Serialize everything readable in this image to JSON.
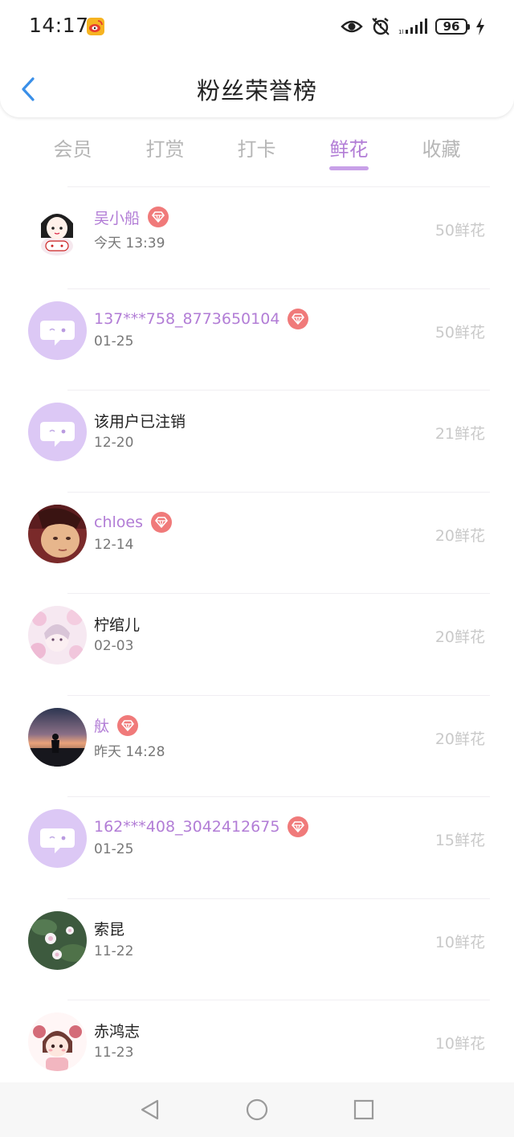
{
  "status_bar": {
    "time": "14:17",
    "battery": "96",
    "icons": [
      "weibo-icon",
      "eye-icon",
      "alarm-icon",
      "signal-icon",
      "battery-icon",
      "charging-icon"
    ]
  },
  "header": {
    "title": "粉丝荣誉榜",
    "back_icon": "chevron-left-icon"
  },
  "tabs": [
    {
      "label": "会员"
    },
    {
      "label": "打赏"
    },
    {
      "label": "打卡"
    },
    {
      "label": "鲜花",
      "active": true
    },
    {
      "label": "收藏"
    }
  ],
  "rows": [
    {
      "name": "吴小船",
      "vip": true,
      "date": "今天 13:39",
      "amount": "50鲜花",
      "avatar": "cartoon-girl-avatar"
    },
    {
      "name": "137***758_8773650104",
      "vip": true,
      "date": "01-25",
      "amount": "50鲜花",
      "avatar": "default-chat-avatar"
    },
    {
      "name": "该用户已注销",
      "vip": false,
      "date": "12-20",
      "amount": "21鲜花",
      "avatar": "default-chat-avatar"
    },
    {
      "name": "chloes",
      "vip": true,
      "date": "12-14",
      "amount": "20鲜花",
      "avatar": "photo-avatar"
    },
    {
      "name": "柠绾儿",
      "vip": false,
      "date": "02-03",
      "amount": "20鲜花",
      "avatar": "pink-flower-avatar"
    },
    {
      "name": "舦",
      "vip": true,
      "date": "昨天 14:28",
      "amount": "20鲜花",
      "avatar": "sunset-silhouette-avatar"
    },
    {
      "name": "162***408_3042412675",
      "vip": true,
      "date": "01-25",
      "amount": "15鲜花",
      "avatar": "default-chat-avatar"
    },
    {
      "name": "索昆",
      "vip": false,
      "date": "11-22",
      "amount": "10鲜花",
      "avatar": "lotus-avatar"
    },
    {
      "name": "赤鸿志",
      "vip": false,
      "date": "11-23",
      "amount": "10鲜花",
      "avatar": "cartoon-girl-avatar-2"
    }
  ],
  "nav_bar": {
    "icons": [
      "back-triangle-icon",
      "home-circle-icon",
      "recents-square-icon"
    ]
  },
  "colors": {
    "accent": "#b27dd6",
    "vip_badge": "#f07a7a",
    "avatar_default_bg": "#dcc8f5",
    "amount": "#c9c9c9"
  }
}
